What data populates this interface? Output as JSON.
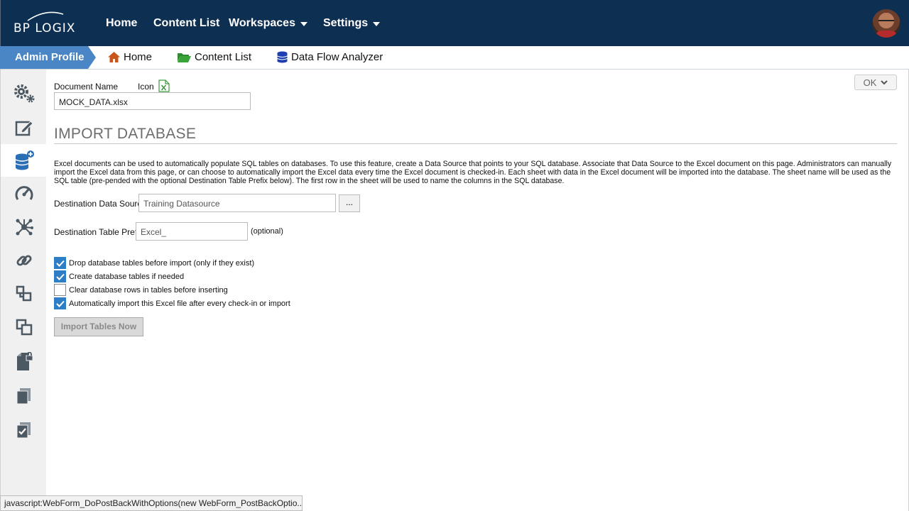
{
  "topnav": {
    "logo_text": "BP LOGIX",
    "items": [
      {
        "label": "Home"
      },
      {
        "label": "Content List"
      },
      {
        "label": "Workspaces"
      },
      {
        "label": "Settings"
      }
    ]
  },
  "breadcrumb": {
    "profile": "Admin Profile",
    "items": [
      {
        "label": "Home",
        "icon": "home-icon"
      },
      {
        "label": "Content List",
        "icon": "folder-icon"
      },
      {
        "label": "Data Flow Analyzer",
        "icon": "database-icon"
      }
    ]
  },
  "sidebar": {
    "items": [
      {
        "icon": "gears-icon"
      },
      {
        "icon": "edit-icon"
      },
      {
        "icon": "database-add-icon",
        "active": true
      },
      {
        "icon": "dashboard-icon"
      },
      {
        "icon": "network-icon"
      },
      {
        "icon": "link-icon"
      },
      {
        "icon": "structure-icon"
      },
      {
        "icon": "copy-icon"
      },
      {
        "icon": "locked-file-icon"
      },
      {
        "icon": "documents-icon"
      },
      {
        "icon": "checked-document-icon"
      }
    ]
  },
  "main": {
    "ok_label": "OK",
    "document_name_label": "Document Name",
    "icon_label": "Icon",
    "document_name_value": "MOCK_DATA.xlsx",
    "section_title": "IMPORT DATABASE",
    "description": "Excel documents can be used to automatically populate SQL tables on databases. To use this feature, create a Data Source that points to your SQL database. Associate that Data Source to the Excel document on this page. Administrators can manually import the Excel data from this page, or can choose to automatically import the Excel data every time the Excel document is checked-in. Each sheet with data in the Excel document will be imported into the database. The sheet name will be used as the SQL table (pre-pended with the optional Destination Table Prefix below). The first row in the sheet will be used to name the columns in the SQL database.",
    "dest_source_label": "Destination Data Source",
    "dest_source_value": "Training Datasource",
    "browse_label": "...",
    "dest_prefix_label": "Destination Table Prefix",
    "dest_prefix_value": "Excel_",
    "optional_label": "(optional)",
    "checkboxes": [
      {
        "label": "Drop database tables before import (only if they exist)",
        "checked": true
      },
      {
        "label": "Create database tables if needed",
        "checked": true
      },
      {
        "label": "Clear database rows in tables before inserting",
        "checked": false
      },
      {
        "label": "Automatically import this Excel file after every check-in or import",
        "checked": true
      }
    ],
    "import_button": "Import Tables Now"
  },
  "statusbar": {
    "text": "javascript:WebForm_DoPostBackWithOptions(new WebForm_PostBackOptio..."
  },
  "colors": {
    "header_bg": "#0d2f52",
    "accent": "#4a86c5",
    "checkbox": "#2d7ec4"
  }
}
